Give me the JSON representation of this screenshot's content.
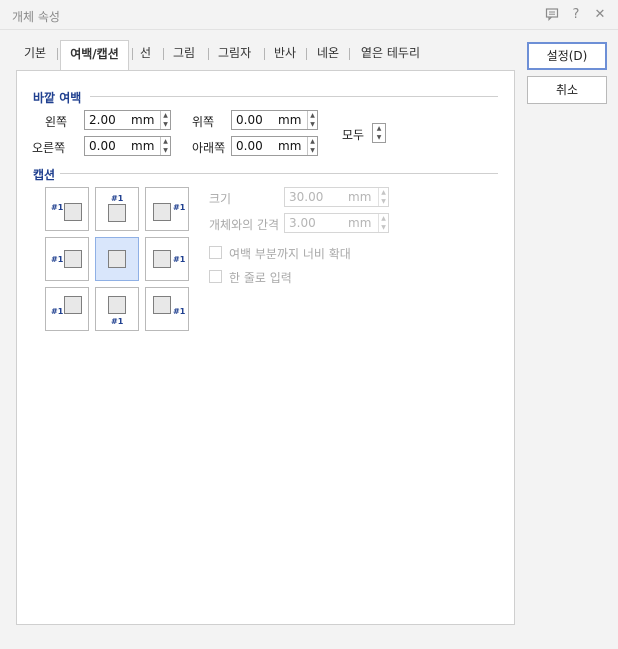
{
  "window": {
    "title": "개체 속성"
  },
  "titlebar_icons": [
    "comment-icon",
    "help-icon",
    "close-icon"
  ],
  "titlebar_glyphs": {
    "help": "?",
    "close": "✕"
  },
  "tabs": [
    {
      "label": "기본"
    },
    {
      "label": "여백/캡션"
    },
    {
      "label": "선"
    },
    {
      "label": "그림"
    },
    {
      "label": "그림자"
    },
    {
      "label": "반사"
    },
    {
      "label": "네온"
    },
    {
      "label": "옅은 테두리"
    }
  ],
  "active_tab": "여백/캡션",
  "outer_margin": {
    "title": "바깥 여백",
    "left": {
      "label": "왼쪽",
      "value": "2.00",
      "unit": "mm"
    },
    "top": {
      "label": "위쪽",
      "value": "0.00",
      "unit": "mm"
    },
    "right": {
      "label": "오른쪽",
      "value": "0.00",
      "unit": "mm"
    },
    "bottom": {
      "label": "아래쪽",
      "value": "0.00",
      "unit": "mm"
    },
    "all_label": "모두"
  },
  "caption": {
    "title": "캡션",
    "position_label": "#1",
    "selected_position": "center",
    "size": {
      "label": "크기",
      "value": "30.00",
      "unit": "mm",
      "enabled": false
    },
    "gap": {
      "label": "개체와의 간격",
      "value": "3.00",
      "unit": "mm",
      "enabled": false
    },
    "expand_width": {
      "label": "여백 부분까지 너비 확대",
      "checked": false,
      "enabled": false
    },
    "single_line": {
      "label": "한 줄로 입력",
      "checked": false,
      "enabled": false
    }
  },
  "buttons": {
    "ok": "설정(D)",
    "cancel": "취소"
  },
  "arrow_glyphs": {
    "up": "▲",
    "down": "▼"
  }
}
